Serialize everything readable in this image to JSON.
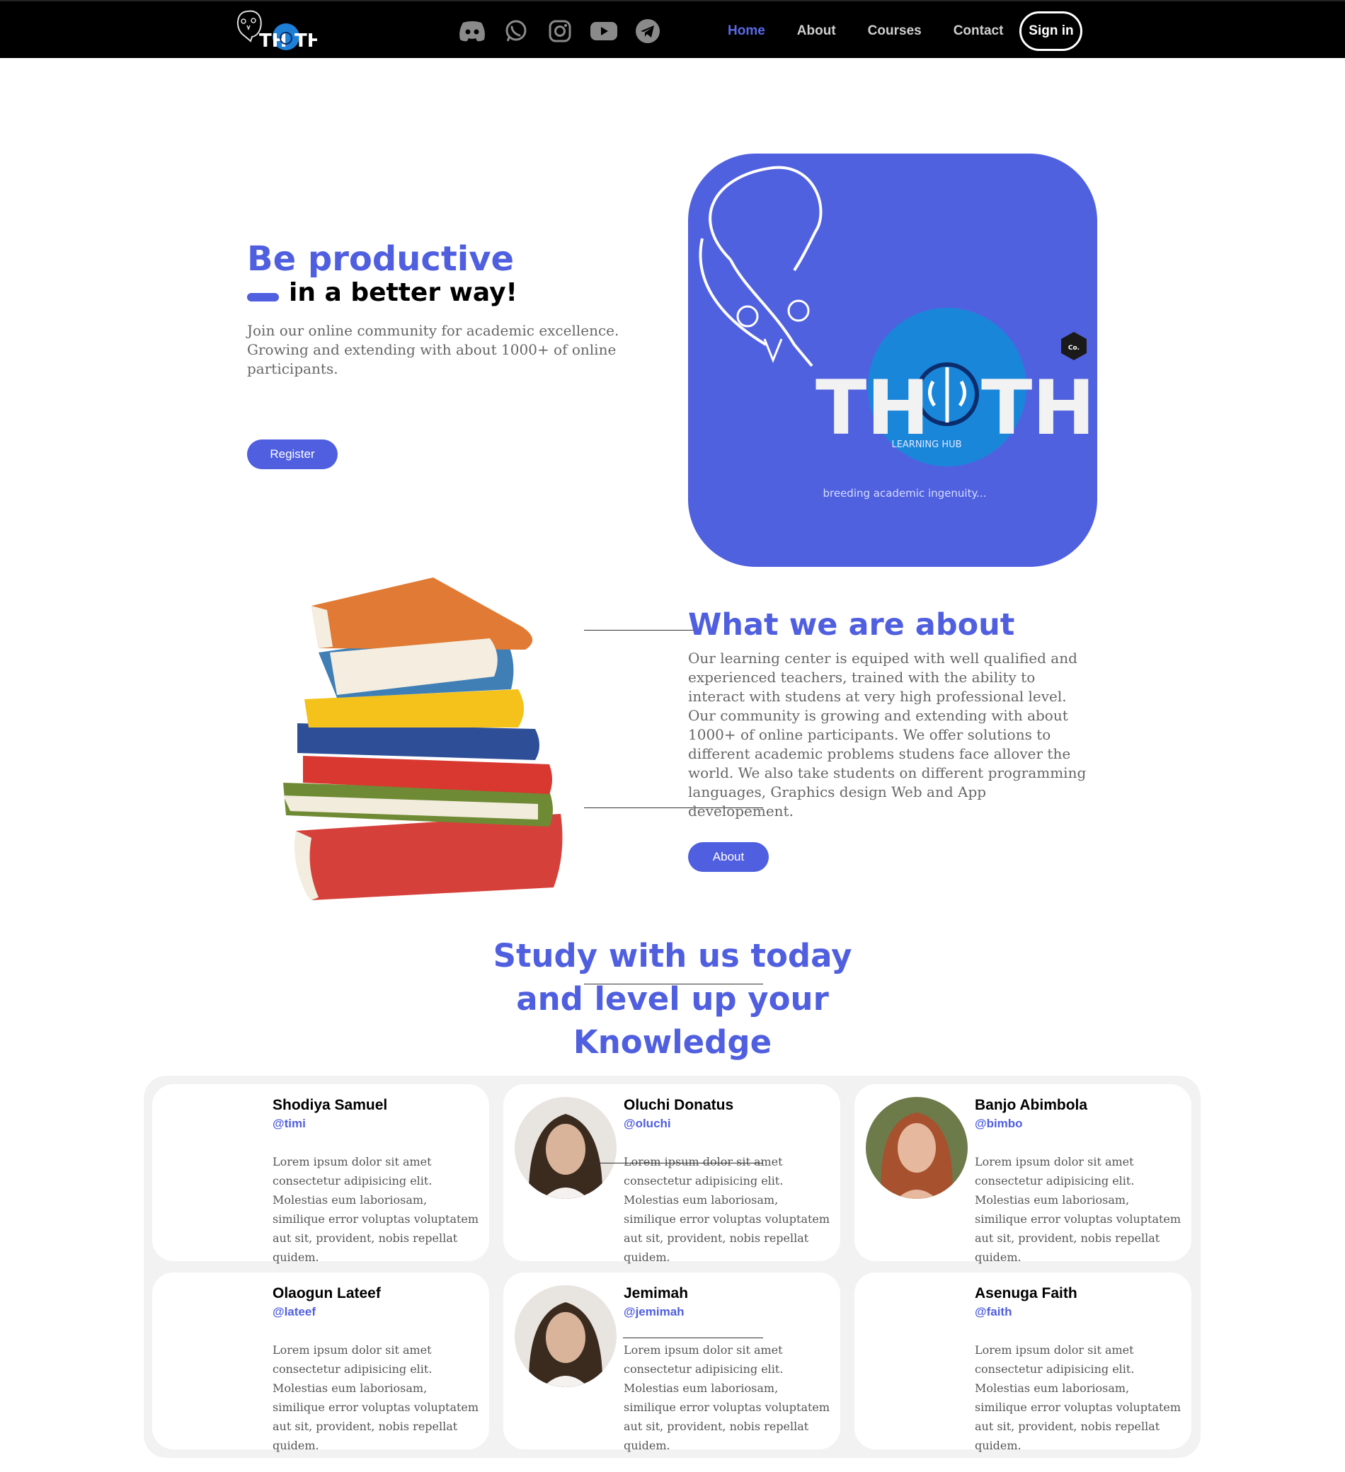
{
  "nav": {
    "logo_text": "TH TH",
    "social": [
      "discord-icon",
      "whatsapp-icon",
      "instagram-icon",
      "youtube-icon",
      "telegram-icon"
    ],
    "links": [
      "Home",
      "About",
      "Courses",
      "Contact"
    ],
    "active": "Home",
    "signin": "Sign in"
  },
  "hero": {
    "title": "Be productive",
    "subtitle": "in a better way!",
    "text": "Join our online community for academic excellence. Growing and extending with about 1000+ of online participants.",
    "register": "Register",
    "card": {
      "brand": "TH TH",
      "hub": "LEARNING HUB",
      "badge": "Co.",
      "tagline": "breeding academic ingenuity..."
    }
  },
  "about": {
    "title": "What we are about",
    "text": "Our learning center is equiped with well qualified and experienced teachers, trained with the ability to interact with studens at very high professional level. Our community is growing and extending with about 1000+ of online participants. We offer solutions to different academic problems studens face allover the world. We also take students on different programming languages, Graphics design Web and App developement.",
    "button": "About"
  },
  "study": {
    "line1": "Study with us today",
    "line2": "and level up your",
    "line3": "Knowledge"
  },
  "testimonials": [
    {
      "name": "Shodiya Samuel",
      "handle": "@timi",
      "text": "Lorem ipsum dolor sit amet consectetur adipisicing elit. Molestias eum laboriosam, similique error voluptas voluptatem aut sit, provident, nobis repellat quidem.",
      "avatar": "none"
    },
    {
      "name": "Oluchi Donatus",
      "handle": "@oluchi",
      "text": "Lorem ipsum dolor sit amet consectetur adipisicing elit. Molestias eum laboriosam, similique error voluptas voluptatem aut sit, provident, nobis repellat quidem.",
      "avatar": "dark-hair"
    },
    {
      "name": "Banjo Abimbola",
      "handle": "@bimbo",
      "text": "Lorem ipsum dolor sit amet consectetur adipisicing elit. Molestias eum laboriosam, similique error voluptas voluptatem aut sit, provident, nobis repellat quidem.",
      "avatar": "red-hair"
    },
    {
      "name": "Olaogun Lateef",
      "handle": "@lateef",
      "text": "Lorem ipsum dolor sit amet consectetur adipisicing elit. Molestias eum laboriosam, similique error voluptas voluptatem aut sit, provident, nobis repellat quidem.",
      "avatar": "none"
    },
    {
      "name": "Jemimah",
      "handle": "@jemimah",
      "text": "Lorem ipsum dolor sit amet consectetur adipisicing elit. Molestias eum laboriosam, similique error voluptas voluptatem aut sit, provident, nobis repellat quidem.",
      "avatar": "dark-hair"
    },
    {
      "name": "Asenuga Faith",
      "handle": "@faith",
      "text": "Lorem ipsum dolor sit amet consectetur adipisicing elit. Molestias eum laboriosam, similique error voluptas voluptatem aut sit, provident, nobis repellat quidem.",
      "avatar": "none"
    }
  ],
  "colors": {
    "accent": "#4f5fe0",
    "nav_bg": "#000000",
    "card_bg": "#5061e0"
  }
}
